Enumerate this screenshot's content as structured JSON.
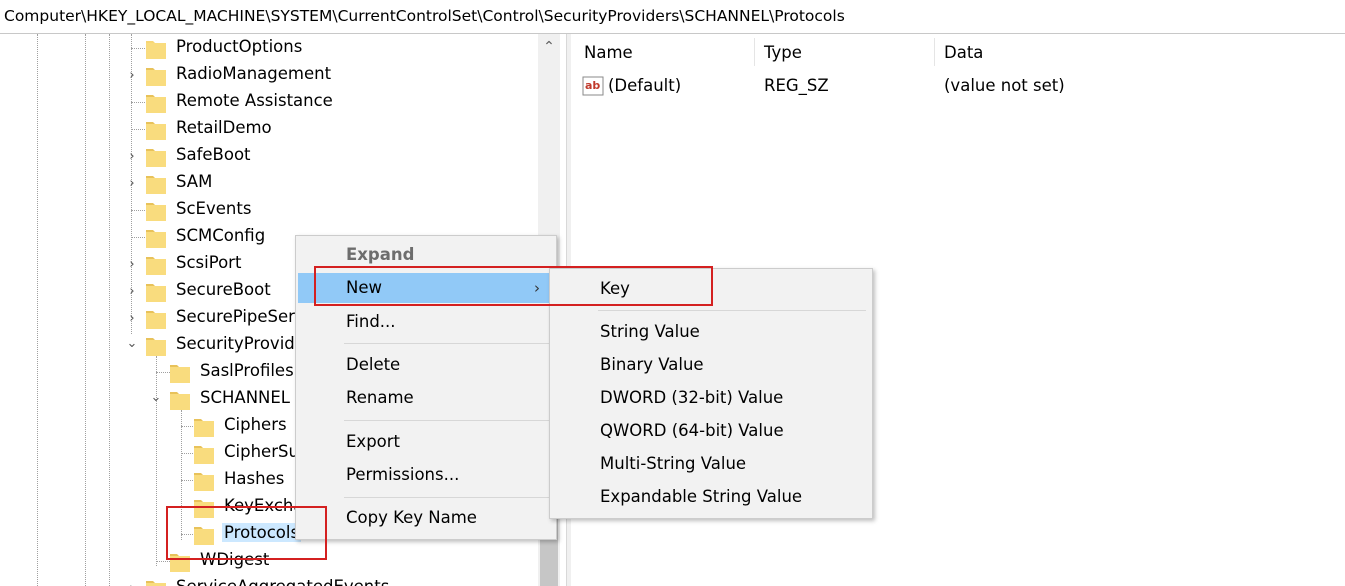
{
  "address_bar": {
    "path": "Computer\\HKEY_LOCAL_MACHINE\\SYSTEM\\CurrentControlSet\\Control\\SecurityProviders\\SCHANNEL\\Protocols"
  },
  "tree": {
    "items": [
      {
        "label": "ProductOptions"
      },
      {
        "label": "RadioManagement"
      },
      {
        "label": "Remote Assistance"
      },
      {
        "label": "RetailDemo"
      },
      {
        "label": "SafeBoot"
      },
      {
        "label": "SAM"
      },
      {
        "label": "ScEvents"
      },
      {
        "label": "SCMConfig"
      },
      {
        "label": "ScsiPort"
      },
      {
        "label": "SecureBoot"
      },
      {
        "label": "SecurePipeServ"
      },
      {
        "label": "SecurityProvide"
      },
      {
        "label": "SaslProfiles"
      },
      {
        "label": "SCHANNEL"
      },
      {
        "label": "Ciphers"
      },
      {
        "label": "CipherSu"
      },
      {
        "label": "Hashes"
      },
      {
        "label": "KeyExcha"
      },
      {
        "label": "Protocols"
      },
      {
        "label": "WDigest"
      },
      {
        "label": "ServiceAggregatedEvents"
      }
    ]
  },
  "list": {
    "columns": {
      "name": "Name",
      "type": "Type",
      "data": "Data"
    },
    "rows": [
      {
        "name": "(Default)",
        "type": "REG_SZ",
        "data": "(value not set)",
        "icon": "string-value-icon"
      }
    ]
  },
  "context_menu": {
    "items": {
      "expand": "Expand",
      "new": "New",
      "find": "Find...",
      "delete": "Delete",
      "rename": "Rename",
      "export": "Export",
      "permissions": "Permissions...",
      "copy_key_name": "Copy Key Name"
    }
  },
  "submenu": {
    "items": {
      "key": "Key",
      "string": "String Value",
      "binary": "Binary Value",
      "dword": "DWORD (32-bit) Value",
      "qword": "QWORD (64-bit) Value",
      "multi": "Multi-String Value",
      "expandable": "Expandable String Value"
    }
  },
  "colors": {
    "highlight": "#91c9f7",
    "selection": "#cce8ff",
    "annotation": "#d42020",
    "folder": "#f8d775"
  }
}
